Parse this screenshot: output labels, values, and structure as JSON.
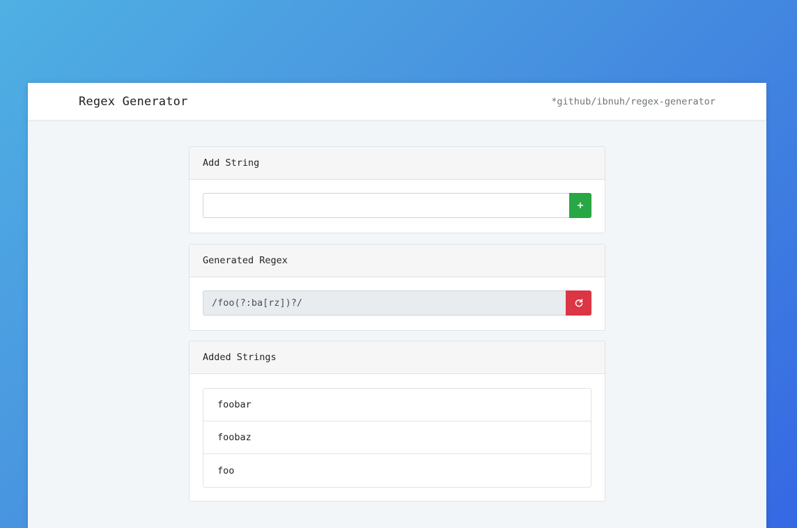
{
  "app": {
    "title": "Regex Generator",
    "github_link": "*github/ibnuh/regex-generator"
  },
  "add_string": {
    "header": "Add String",
    "input_value": "",
    "input_placeholder": "",
    "button_label": "+"
  },
  "generated_regex": {
    "header": "Generated Regex",
    "value": "/foo(?:ba[rz])?/",
    "reset_icon": "refresh-icon"
  },
  "added_strings": {
    "header": "Added Strings",
    "items": [
      "foobar",
      "foobaz",
      "foo"
    ]
  },
  "colors": {
    "add_button": "#28a745",
    "reset_button": "#dc3545",
    "background_gradient_start": "#4fb0e3",
    "background_gradient_end": "#3568e4"
  }
}
